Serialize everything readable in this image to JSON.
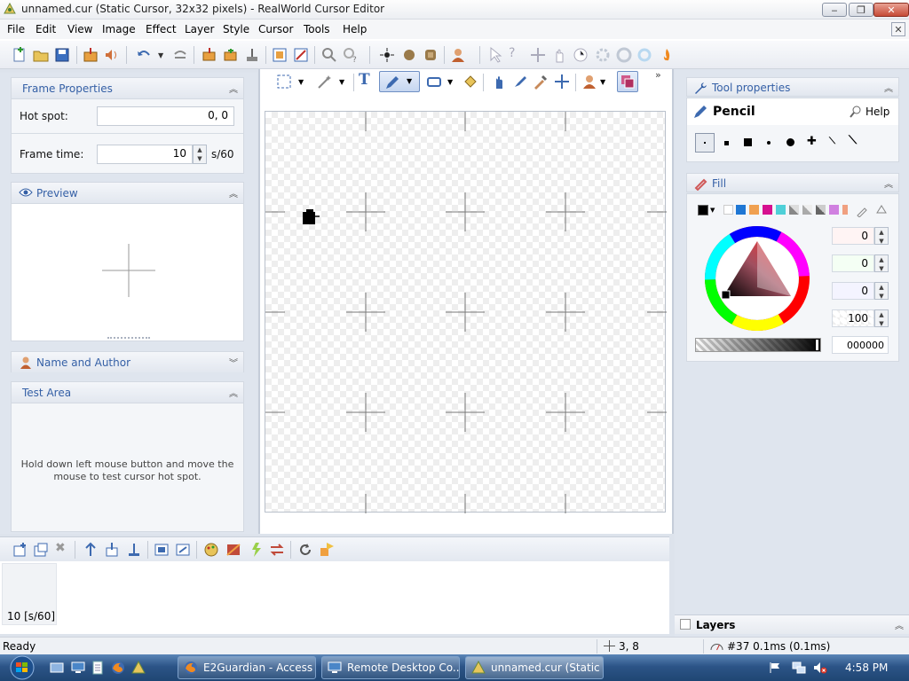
{
  "window": {
    "title": "unnamed.cur (Static Cursor, 32x32 pixels) - RealWorld Cursor Editor",
    "minimize": "‒",
    "maximize": "❐",
    "close": "✕"
  },
  "menu": {
    "items": [
      "File",
      "Edit",
      "View",
      "Image",
      "Effect",
      "Layer",
      "Style",
      "Cursor",
      "Tools",
      "Help"
    ],
    "mdi_close": "✕"
  },
  "frame_properties": {
    "title": "Frame Properties",
    "hotspot_label": "Hot spot:",
    "hotspot_value": "0, 0",
    "frametime_label": "Frame time:",
    "frametime_value": "10",
    "frametime_unit": "s/60"
  },
  "preview": {
    "title": "Preview"
  },
  "name_author": {
    "title": "Name and Author"
  },
  "test_area": {
    "title": "Test Area",
    "hint": "Hold down left mouse button and move the mouse to test cursor hot spot."
  },
  "tool_properties": {
    "title": "Tool properties",
    "tool_name": "Pencil",
    "help_label": "Help"
  },
  "fill": {
    "title": "Fill",
    "channel_values": [
      "0",
      "0",
      "0",
      "100"
    ],
    "hex_value": "000000",
    "swatches": [
      "#000000",
      "#ffffff",
      "#1f77d4",
      "#f0a050",
      "#d6108f",
      "#4fd0d8",
      "#9a9a9a",
      "#c0c0c0",
      "#707070",
      "#d080e0",
      "#f0a080"
    ]
  },
  "frames": {
    "frame_label": "10 [s/60]"
  },
  "layers": {
    "title": "Layers"
  },
  "status": {
    "ready": "Ready",
    "coords": "3, 8",
    "info": "#37 0.1ms (0.1ms)"
  },
  "taskbar": {
    "tasks": [
      "E2Guardian - Access ...",
      "Remote Desktop Co...",
      "unnamed.cur (Static ..."
    ],
    "clock": "4:58 PM"
  },
  "colors": {
    "accent_text": "#3560a6",
    "panel_bg": "#dfe5ee",
    "taskbar": "#2c5487"
  }
}
